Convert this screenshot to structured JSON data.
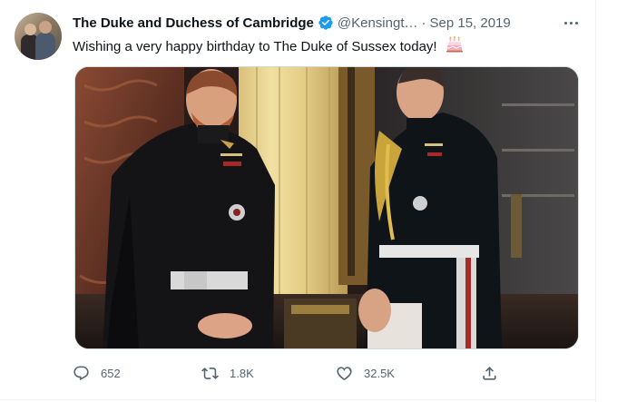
{
  "tweet": {
    "author": {
      "display_name": "The Duke and Duchess of Cambridge",
      "handle": "@Kensingt…",
      "verified": true
    },
    "separator": "·",
    "date": "Sep 15, 2019",
    "text": "Wishing a very happy birthday to The Duke of Sussex today!",
    "emoji": "birthday-cake-icon",
    "metrics": {
      "replies": "652",
      "retweets": "1.8K",
      "likes": "32.5K"
    }
  },
  "colors": {
    "verified_blue": "#1d9bf0",
    "secondary_text": "#536471",
    "primary_text": "#0f1419",
    "border": "#cfd9de"
  }
}
